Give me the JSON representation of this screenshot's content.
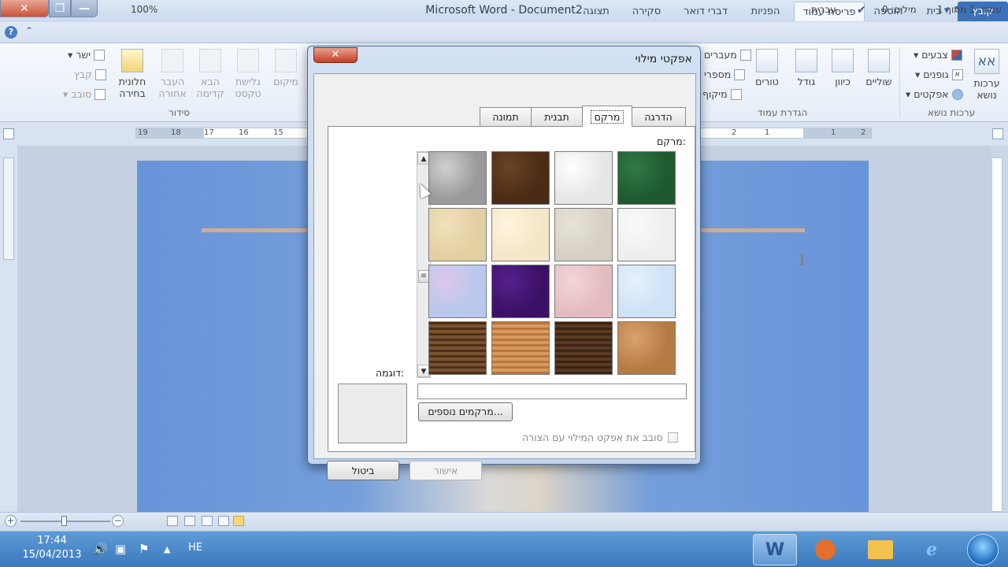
{
  "window": {
    "title": "Microsoft Word  -  Document2",
    "close_glyph": "✕",
    "maximize_glyph": "❐",
    "minimize_glyph": "—"
  },
  "ribbon_tabs": [
    {
      "label": "קובץ",
      "state": "file"
    },
    {
      "label": "בית",
      "state": ""
    },
    {
      "label": "הוספה",
      "state": ""
    },
    {
      "label": "פריסת עמוד",
      "state": "active"
    },
    {
      "label": "הפניות",
      "state": ""
    },
    {
      "label": "דברי דואר",
      "state": ""
    },
    {
      "label": "סקירה",
      "state": ""
    },
    {
      "label": "תצוגה",
      "state": ""
    }
  ],
  "ribbon": {
    "themes": {
      "big": "ערכות\nנושא",
      "colors": "צבעים",
      "fonts": "גופנים",
      "effects": "אפקטים",
      "group": "ערכות נושא"
    },
    "page_setup": {
      "margins": "שוליים",
      "orientation": "כיוון",
      "size": "גודל",
      "columns": "טורים",
      "breaks": "מעברים",
      "line_numbers": "מספרי",
      "hyphenation": "מיקוף",
      "group": "הגדרת עמוד"
    },
    "arrange": {
      "selection_pane": "חלונית\nבחירה",
      "send_backward": "העבר\nאחורה",
      "bring_forward": "הבא\nקדימה",
      "wrap_text": "גלישת\nטקסט",
      "position": "מיקום",
      "align": "ישר",
      "group_btn": "קבץ",
      "rotate": "סובב",
      "group": "סידור"
    }
  },
  "ruler": {
    "left_numbers": [
      "19",
      "18",
      "17",
      "16",
      "15"
    ],
    "right_numbers": [
      "2",
      "1",
      "1",
      "2"
    ]
  },
  "document": {
    "page_number": "1"
  },
  "status": {
    "page": "עמוד: 1 מתוך 1",
    "words": "מילים: 0",
    "language": "עברית",
    "zoom": "100%",
    "zoom_level_percent": 100,
    "zoom_out": "−",
    "zoom_in": "+"
  },
  "taskbar": {
    "time": "17:44",
    "date": "15/04/2013",
    "lang": "HE",
    "word_label": "W"
  },
  "dialog": {
    "title": "אפקטי מילוי",
    "close_glyph": "✕",
    "tabs": [
      {
        "label": "הדרגה",
        "selected": false
      },
      {
        "label": "מרקם",
        "selected": true
      },
      {
        "label": "תבנית",
        "selected": false
      },
      {
        "label": "תמונה",
        "selected": false
      }
    ],
    "texture_label": "מרקם:",
    "preview_label": "דוגמה:",
    "texture_name_value": "",
    "more_textures": "מרקמים נוספים...",
    "rotate_checkbox": "סובב את אפקט המילוי עם הצורה",
    "rotate_checked": false,
    "ok": "אישור",
    "cancel": "ביטול",
    "scroll_up": "▲",
    "scroll_down": "▼",
    "scroll_grip": "≡"
  },
  "textures": [
    {
      "name": "green-marble-texture",
      "c1": "#1f5a2e",
      "c2": "#2f7a45"
    },
    {
      "name": "white-marble-texture",
      "c1": "#e6e6e6",
      "c2": "#ffffff"
    },
    {
      "name": "brown-marble-texture",
      "c1": "#4a2c16",
      "c2": "#6b4225"
    },
    {
      "name": "granite-texture",
      "c1": "#9a9a9a",
      "c2": "#d0d0d0"
    },
    {
      "name": "white-paper-texture",
      "c1": "#eeeeee",
      "c2": "#fafafa"
    },
    {
      "name": "recycled-paper-texture",
      "c1": "#d6d0c4",
      "c2": "#e8e3d8"
    },
    {
      "name": "parchment-texture",
      "c1": "#f4e6c8",
      "c2": "#fff4dc"
    },
    {
      "name": "sand-texture",
      "c1": "#e3cfa2",
      "c2": "#f1e1bb"
    },
    {
      "name": "blue-tissue-texture",
      "c1": "#cfe2f6",
      "c2": "#e6f1fc"
    },
    {
      "name": "pink-tissue-texture",
      "c1": "#e4bcc0",
      "c2": "#f2d6d8"
    },
    {
      "name": "purple-mesh-texture",
      "c1": "#3b1166",
      "c2": "#55208c"
    },
    {
      "name": "bouquet-texture",
      "c1": "#b9c8ec",
      "c2": "#dcc7ea"
    },
    {
      "name": "cork-texture",
      "c1": "#b57b45",
      "c2": "#d9a26b"
    },
    {
      "name": "walnut-texture",
      "c1": "#3a2414",
      "c2": "#5a3a22"
    },
    {
      "name": "oak-texture",
      "c1": "#b9773c",
      "c2": "#d89a5c"
    },
    {
      "name": "medium-wood-texture",
      "c1": "#4e2f16",
      "c2": "#7a5230"
    }
  ]
}
